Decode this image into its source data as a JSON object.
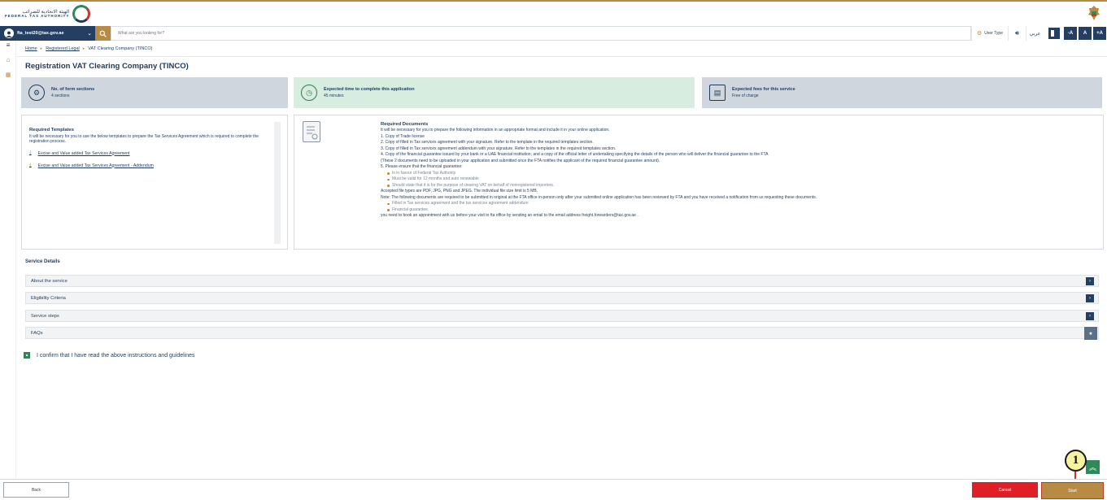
{
  "header": {
    "logo_ar": "الهيئة الاتحادية للضرائب",
    "logo_en": "FEDERAL TAX AUTHORITY"
  },
  "nav": {
    "user_email": "fta_test20@tax.gov.ae",
    "search_placeholder": "What are you looking for?",
    "user_type_label": "User Type",
    "language": "عربي",
    "font_decrease": "-A",
    "font_reset": "A",
    "font_increase": "+A"
  },
  "breadcrumb": {
    "home": "Home",
    "registered_legal": "Registered Legal",
    "current": "VAT Clearing Company (TINCO)"
  },
  "page": {
    "title": "Registration VAT Clearing Company (TINCO)"
  },
  "cards": [
    {
      "title": "No. of form sections",
      "value": "4 sections"
    },
    {
      "title": "Expected time to complete this application",
      "value": "45 minutes"
    },
    {
      "title": "Expected fees for this service",
      "value": "Free of charge"
    }
  ],
  "templates": {
    "heading": "Required Templates",
    "intro": "It will be necessary for you to use the below templates to prepare the Tax Services Agreement which is required to complete the registration process.",
    "links": [
      "Excise and Value added Tax Services Agreement",
      "Excise and Value added Tax Services Agreement - Addendum"
    ]
  },
  "documents": {
    "heading": "Required Documents",
    "intro": "It will be necessary for you to prepare the following information in an appropriate format and include it in your online application.",
    "items": [
      "1. Copy of Trade license",
      "2. Copy of filled in Tax services agreement with your signature. Refer to the template in the required templates section.",
      "3. Copy of filled in Tax services agreement addendum with your signature. Refer to the templates in the required templates section.",
      "4. Copy of the financial guarantee issued by your bank or a UAE financial institution; and a copy of the official letter of undertaking specifying the details of the person who will deliver the financial guarantee to the FTA",
      "(These 2 documents need to be uploaded in your application and submitted once the FTA notifies the applicant of the required financial guarantee amount).",
      "5. Please ensure that the financial guarantee:"
    ],
    "guarantee_bullets": [
      "Is in favour of Federal Tax Authority",
      "Must be valid for 12 months and auto renewable",
      "Should state that it is for the purpose of clearing VAT on behalf of nonregistered importers."
    ],
    "file_types": "Accepted file types are PDF, JPG, PNG and JPEG. The individual file size limit is 5 MB.",
    "note": "Note: The following documents are required to be submitted in original at the FTA office in-person only after your submitted online application has been reviewed by FTA and you have received a notification from us requesting these documents.",
    "note_bullets": [
      "Filled in Tax services agreement and the tax services agreement addendum",
      "Financial guarantee."
    ],
    "appointment": "you need to book an appointment with us before your visit to fta office by sending an email to the email address freight.forwarders@tax.gov.ae ."
  },
  "service_details": {
    "title": "Service Details",
    "sections": [
      "About the service",
      "Eligibility Criteria",
      "Service steps",
      "FAQs"
    ]
  },
  "confirm": {
    "label": "I confirm that I have read the above instructions and guidelines",
    "checked": true
  },
  "footer": {
    "back": "Back",
    "cancel": "Cancel",
    "start": "Start"
  },
  "annotation": {
    "marker": "1"
  },
  "colors": {
    "navy": "#243f61",
    "gold": "#b78b43",
    "green": "#2e8b57",
    "red": "#e01e26"
  }
}
